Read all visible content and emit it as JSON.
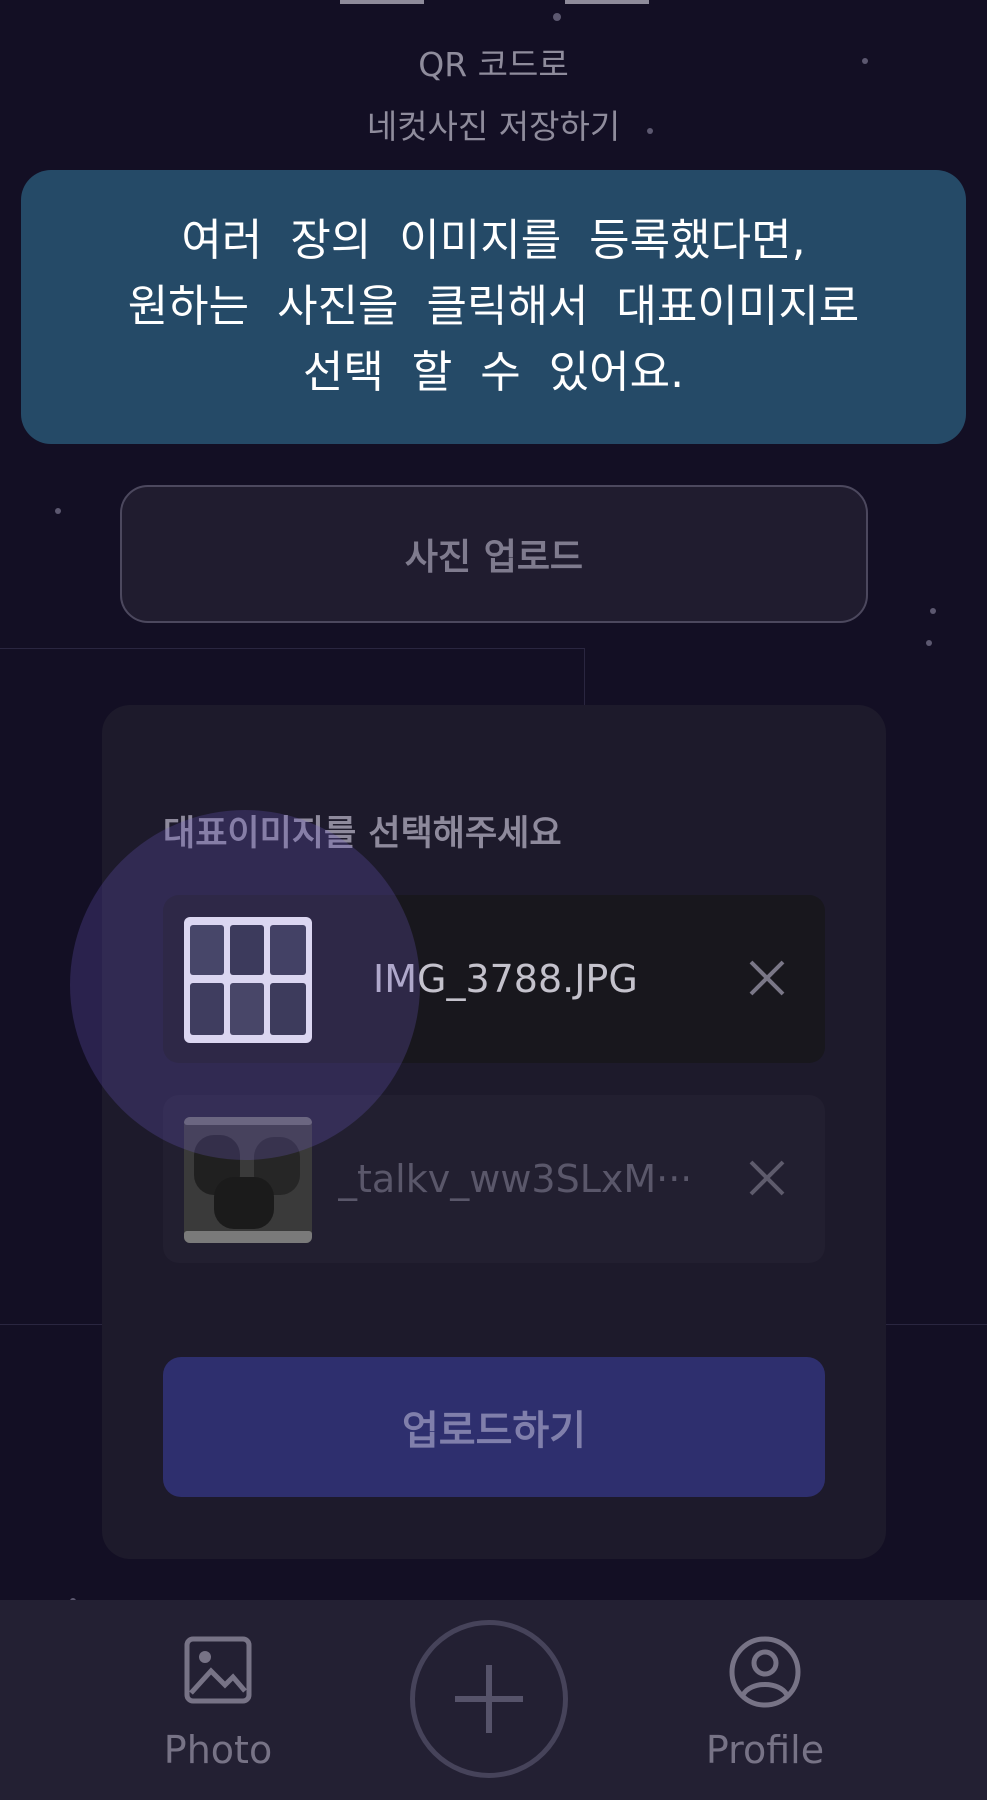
{
  "qr_section": {
    "line1": "QR 코드로",
    "line2": "네컷사진 저장하기"
  },
  "tooltip": {
    "lines": [
      "여러  장의  이미지를  등록했다면,",
      "원하는  사진을  클릭해서  대표이미지로",
      "선택  할  수  있어요."
    ]
  },
  "upload_photo_button": "사진 업로드",
  "panel": {
    "title": "대표이미지를 선택해주세요",
    "files": [
      {
        "name": "IMG_3788.JPG",
        "thumb_icon": "photo-strip-thumbnail"
      },
      {
        "name": "_talkv_ww3SLxM···",
        "thumb_icon": "group-photo-thumbnail"
      }
    ],
    "submit_label": "업로드하기"
  },
  "nav": {
    "photo_label": "Photo",
    "profile_label": "Profile",
    "photo_icon": "image-icon",
    "add_icon": "plus-icon",
    "profile_icon": "user-circle-icon"
  },
  "colors": {
    "background": "#130f24",
    "tooltip_bg": "#254a67",
    "submit_bg": "#2e2f6e",
    "nav_bg": "#232033"
  }
}
